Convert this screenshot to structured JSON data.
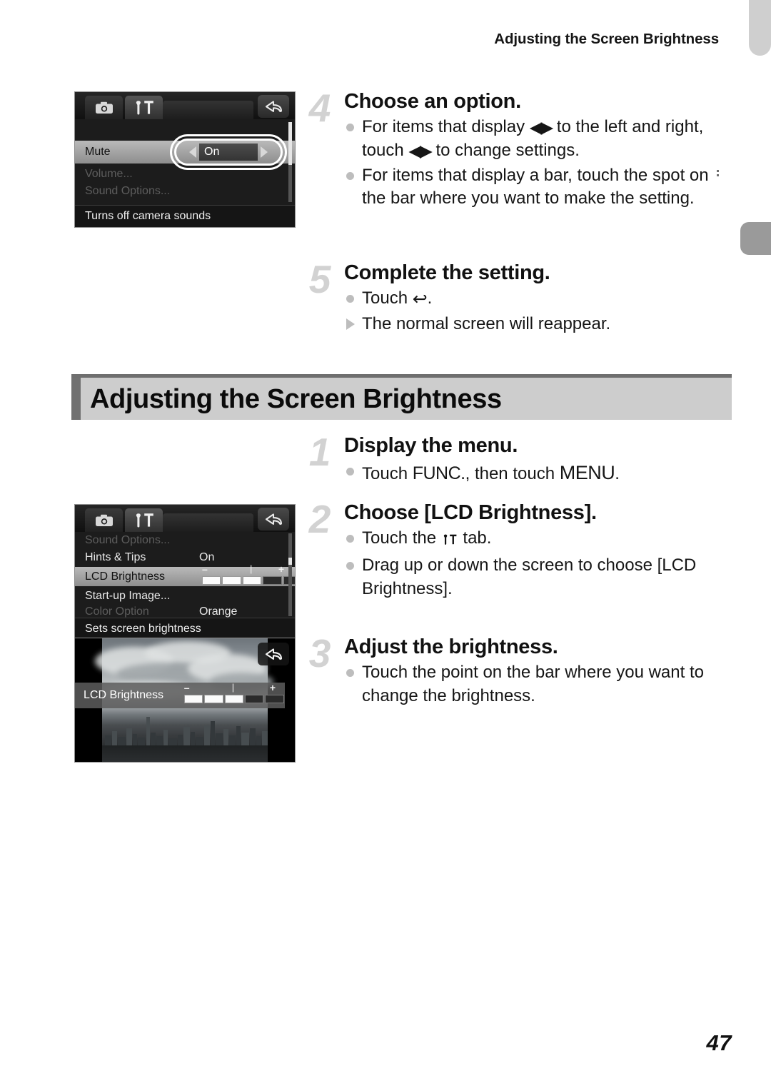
{
  "page": {
    "running_head": "Adjusting the Screen Brightness",
    "number": "47"
  },
  "section": {
    "title": "Adjusting the Screen Brightness"
  },
  "steps_top": [
    {
      "num": "4",
      "title": "Choose an option.",
      "bullets": [
        {
          "kind": "dot",
          "pre": "For items that display ",
          "glyph": "◀▶",
          "mid": " to the left and right, touch ",
          "glyph2": "◀▶",
          "post": " to change settings."
        },
        {
          "kind": "dot",
          "pre": "For items that display a bar, touch the spot on the bar where you want to make the setting.",
          "glyph": "",
          "mid": "",
          "glyph2": "",
          "post": ""
        }
      ]
    },
    {
      "num": "5",
      "title": "Complete the setting.",
      "bullets": [
        {
          "kind": "dot",
          "pre": "Touch ",
          "glyph": "↰",
          "mid": "",
          "glyph2": "",
          "post": "."
        },
        {
          "kind": "tri",
          "pre": "The normal screen will reappear.",
          "glyph": "",
          "mid": "",
          "glyph2": "",
          "post": ""
        }
      ]
    }
  ],
  "steps_bottom": [
    {
      "num": "1",
      "title": "Display the menu.",
      "bullet_func": {
        "pre": "Touch ",
        "func": "FUNC.",
        "mid": ", then touch ",
        "menu": "MENU",
        "post": "."
      }
    },
    {
      "num": "2",
      "title": "Choose [LCD Brightness].",
      "bullets": [
        {
          "kind": "dot",
          "pre": "Touch the ",
          "icon": "tools-tab-icon",
          "post": " tab."
        },
        {
          "kind": "dot",
          "pre": "Drag up or down the screen to choose [LCD Brightness].",
          "icon": "",
          "post": ""
        }
      ]
    },
    {
      "num": "3",
      "title": "Adjust the brightness.",
      "bullets": [
        {
          "kind": "dot",
          "pre": "Touch the point on the bar where you want to change the brightness.",
          "icon": "",
          "post": ""
        }
      ]
    }
  ],
  "screen_sound": {
    "tabs": {
      "camera": "camera-tab",
      "tools": "tools-tab",
      "back": "back-button"
    },
    "rows": [
      {
        "label": "",
        "value": "",
        "state": "blank-top"
      },
      {
        "label": "Mute",
        "value": "On",
        "state": "selected-stepper"
      },
      {
        "label": "Volume...",
        "value": "",
        "state": "dim"
      },
      {
        "label": "Sound Options...",
        "value": "",
        "state": "dim-clipped"
      }
    ],
    "hint": "Turns off camera sounds"
  },
  "screen_menu": {
    "rows": [
      {
        "label": "Sound Options...",
        "value": "",
        "state": "dim-clipped-top"
      },
      {
        "label": "Hints & Tips",
        "value": "On",
        "state": "normal"
      },
      {
        "label": "LCD Brightness",
        "value": "",
        "state": "selected-slider"
      },
      {
        "label": "Start-up Image...",
        "value": "",
        "state": "normal"
      },
      {
        "label": "Color Option",
        "value": "Orange",
        "state": "dim-clipped-bottom"
      }
    ],
    "hint": "Sets screen brightness"
  },
  "screen_photo": {
    "osd_label": "LCD Brightness",
    "back": "back-button"
  },
  "slider": {
    "minus": "–",
    "plus": "+",
    "mid": "|",
    "segments": [
      true,
      true,
      true,
      false,
      false
    ]
  },
  "colors": {
    "section_bar": "#cdcdcd",
    "section_accent": "#717171",
    "step_number": "#d2d2d2",
    "bullet": "#bdbdbd",
    "screen_bg": "#1c1c1c",
    "row_selected": "#b9b9b9"
  }
}
